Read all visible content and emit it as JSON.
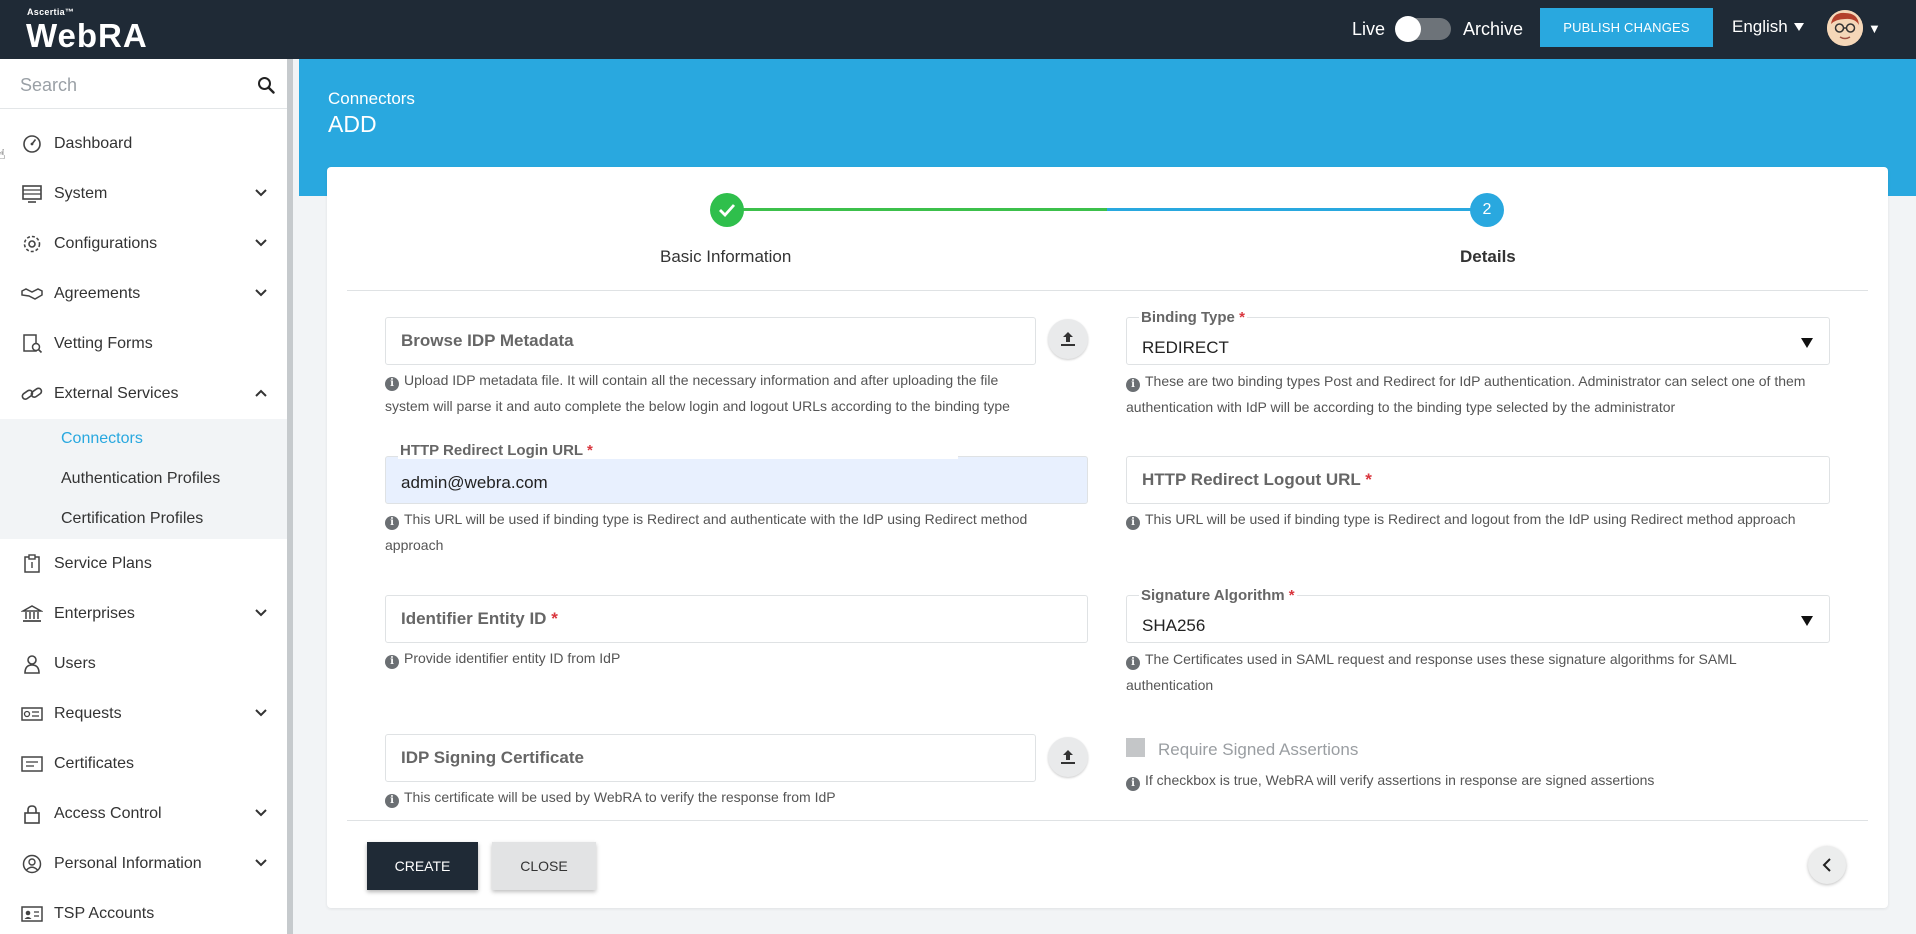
{
  "app": {
    "brand_small": "Ascertia™",
    "brand_name": "WebRA"
  },
  "topbar": {
    "live_label": "Live",
    "archive_label": "Archive",
    "publish_label": "PUBLISH CHANGES",
    "language": "English"
  },
  "sidebar": {
    "search_placeholder": "Search",
    "items": [
      {
        "label": "Dashboard",
        "icon": "dashboard-icon"
      },
      {
        "label": "System",
        "icon": "system-icon"
      },
      {
        "label": "Configurations",
        "icon": "gear-icon"
      },
      {
        "label": "Agreements",
        "icon": "handshake-icon"
      },
      {
        "label": "Vetting Forms",
        "icon": "vetting-icon"
      },
      {
        "label": "External Services",
        "icon": "link-icon"
      },
      {
        "label": "Service Plans",
        "icon": "service-plan-icon"
      },
      {
        "label": "Enterprises",
        "icon": "bank-icon"
      },
      {
        "label": "Users",
        "icon": "user-icon"
      },
      {
        "label": "Requests",
        "icon": "requests-icon"
      },
      {
        "label": "Certificates",
        "icon": "certificate-icon"
      },
      {
        "label": "Access Control",
        "icon": "lock-icon"
      },
      {
        "label": "Personal Information",
        "icon": "person-icon"
      },
      {
        "label": "TSP Accounts",
        "icon": "tsp-icon"
      }
    ],
    "sub_items": [
      {
        "label": "Connectors",
        "active": true
      },
      {
        "label": "Authentication Profiles"
      },
      {
        "label": "Certification Profiles"
      }
    ]
  },
  "page": {
    "breadcrumb": "Connectors",
    "title": "ADD"
  },
  "stepper": {
    "step1_label": "Basic Information",
    "step2_number": "2",
    "step2_label": "Details"
  },
  "form": {
    "browse_metadata": {
      "placeholder": "Browse IDP Metadata",
      "hint": "Upload IDP metadata file. It will contain all the necessary information and after uploading the file system will parse it and auto complete the below login and logout URLs according to the binding type"
    },
    "binding_type": {
      "label": "Binding Type",
      "value": "REDIRECT",
      "hint": "These are two binding types Post and Redirect for IdP authentication. Administrator can select one of them authentication with IdP will be according to the binding type selected by the administrator"
    },
    "login_url": {
      "label": "HTTP Redirect Login URL",
      "value": "admin@webra.com",
      "hint": "This URL will be used if binding type is Redirect and authenticate with the IdP using Redirect method approach"
    },
    "logout_url": {
      "placeholder": "HTTP Redirect Logout URL",
      "hint": "This URL will be used if binding type is Redirect and logout from the IdP using Redirect method approach"
    },
    "entity_id": {
      "placeholder": "Identifier Entity ID",
      "hint": "Provide identifier entity ID from IdP"
    },
    "signature_algorithm": {
      "label": "Signature Algorithm",
      "value": "SHA256",
      "hint": "The Certificates used in SAML request and response uses these signature algorithms for SAML authentication"
    },
    "signing_cert": {
      "placeholder": "IDP Signing Certificate",
      "hint": "This certificate will be used by WebRA to verify the response from IdP"
    },
    "signed_assertions": {
      "label": "Require Signed Assertions",
      "hint": "If checkbox is true, WebRA will verify assertions in response are signed assertions"
    },
    "required_mark": "*"
  },
  "actions": {
    "create_label": "CREATE",
    "close_label": "CLOSE"
  }
}
